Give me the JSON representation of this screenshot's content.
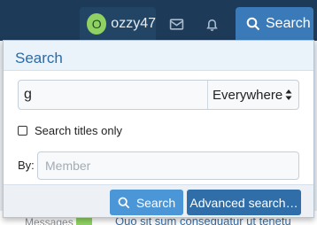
{
  "nav": {
    "avatar_letter": "O",
    "username": "ozzy47",
    "inbox_icon": "envelope-icon",
    "alerts_icon": "bell-icon",
    "search_label": "Search"
  },
  "background": {
    "row_label": "Messages",
    "thread_link": "Quo sit sum consequatur ut tenetu"
  },
  "search_panel": {
    "title": "Search",
    "keywords_value": "g",
    "scope_selected": "Everywhere",
    "titles_only_label": "Search titles only",
    "titles_only_checked": false,
    "by_label": "By:",
    "member_placeholder": "Member",
    "search_button": "Search",
    "advanced_button": "Advanced search…"
  },
  "colors": {
    "nav_bg": "#1d3a59",
    "accent": "#3b7ab8",
    "primary_button": "#4a96d6",
    "secondary_button": "#2f6ea8",
    "avatar_bg": "#8fd162"
  }
}
